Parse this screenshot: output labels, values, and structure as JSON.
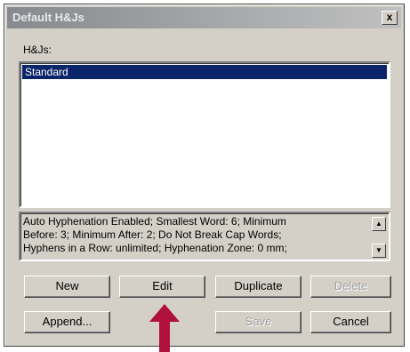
{
  "window": {
    "title": "Default H&Js",
    "close_label": "x"
  },
  "hjs_label": "H&Js:",
  "list": {
    "items": [
      "Standard"
    ],
    "selected": "Standard"
  },
  "info": {
    "lines": [
      "Auto Hyphenation Enabled;  Smallest Word: 6;  Minimum",
      "Before: 3;  Minimum After: 2;  Do Not Break Cap Words;",
      "Hyphens in a Row: unlimited;  Hyphenation Zone: 0 mm;"
    ]
  },
  "buttons": {
    "new": "New",
    "edit": "Edit",
    "duplicate": "Duplicate",
    "delete": "Delete",
    "append": "Append...",
    "save": "Save",
    "cancel": "Cancel"
  },
  "colors": {
    "selection": "#0a246a",
    "arrow": "#b0103c"
  },
  "icons": {
    "close": "close-icon",
    "scroll_up": "scroll-up-icon",
    "scroll_down": "scroll-down-icon",
    "annotation_arrow": "up-arrow-icon"
  }
}
